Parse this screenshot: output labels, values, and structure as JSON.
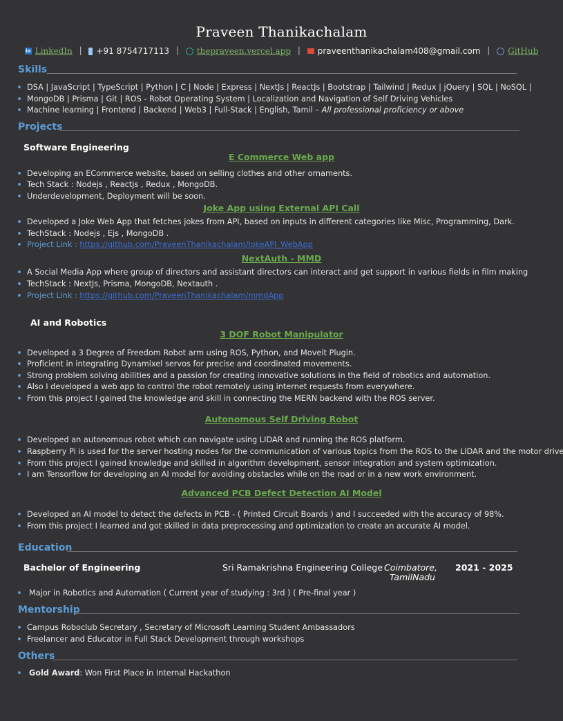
{
  "header": {
    "name": "Praveen Thanikachalam",
    "linkedin": "LinkedIn",
    "phone": "+91 8754717113",
    "website": "thepraveen.vercel.app",
    "email": "praveenthanikachalam408@gmail.com",
    "github": "GitHub",
    "separator": "|"
  },
  "skills": {
    "title": "Skills",
    "lines": [
      "DSA |  JavaScript | TypeScript | Python | C | Node | Express | NextJs | ReactJs | Bootstrap | Tailwind | Redux | jQuery | SQL | NoSQL |",
      "MongoDB | Prisma | Git | ROS - Robot Operating System | Localization and Navigation of Self Driving Vehicles",
      "Machine learning | Frontend | Backend | Web3 | Full-Stack | English, Tamil – "
    ],
    "proficiency": "All professional proficiency or above"
  },
  "projects": {
    "title": "Projects",
    "software": {
      "title": "Software Engineering",
      "items": [
        {
          "name": "E Commerce Web app",
          "bullets": [
            "Developing an ECommerce website, based on selling clothes and other ornaments.",
            "Tech Stack : Nodejs , Reactjs , Redux , MongoDB.",
            "Underdevelopment, Deployment will be soon."
          ]
        },
        {
          "name": "Joke App using External API Call",
          "bullets": [
            "Developed a Joke Web App that fetches jokes from API, based on inputs in different categories like Misc, Programming, Dark.",
            "TechStack : Nodejs , Ejs , MongoDB ."
          ],
          "link_label": "Project Link : ",
          "link": "https://github.com/PraveenThanikachalam/JokeAPI_WebApp"
        },
        {
          "name": "NextAuth - MMD",
          "bullets": [
            "A Social Media App  where group of directors and assistant directors can interact and get support in various fields in film making",
            "TechStack : NextJs, Prisma, MongoDB, Nextauth ."
          ],
          "link_label": "Project Link : ",
          "link": "https://github.com/PraveenThanikachalam/mmdApp"
        }
      ]
    },
    "ai": {
      "title": "AI and Robotics",
      "items": [
        {
          "name": "3 DOF Robot Manipulator",
          "bullets": [
            "Developed a 3 Degree of Freedom Robot arm using ROS, Python, and Moveit Plugin.",
            "Proficient in integrating Dynamixel servos for precise and coordinated movements.",
            "Strong problem solving abilities and a passion for creating innovative solutions in the field of robotics and automation.",
            "Also I developed a web app to control the robot remotely using internet requests from everywhere.",
            "From this project I gained the knowledge and skill in connecting the MERN backend with the ROS server."
          ]
        },
        {
          "name": "Autonomous Self Driving Robot",
          "bullets": [
            "Developed an autonomous robot which can navigate using LIDAR and running the ROS platform.",
            "Raspberry Pi is used for the server hosting nodes for the communication of various topics from the ROS to the LIDAR and the motor driver.",
            "From this project I gained knowledge and skilled in algorithm development, sensor integration and system optimization.",
            "I am Tensorflow for developing an AI model for avoiding obstacles while on the road or in a new work environment."
          ]
        },
        {
          "name": "Advanced PCB Defect Detection AI Model",
          "bullets": [
            "Developed an AI model to detect the defects in PCB - ( Printed Circuit Boards ) and I succeeded with the accuracy of 98%.",
            "From this project I learned and got skilled in data preprocessing and optimization to create an accurate AI model."
          ]
        }
      ]
    }
  },
  "education": {
    "title": "Education",
    "degree": "Bachelor of Engineering",
    "college": "Sri Ramakrishna Engineering College",
    "city": "Coimbatore,",
    "state": "TamilNadu",
    "years": "2021 - 2025",
    "bullet": "Major in Robotics and Automation ( Current year of studying : 3rd ) ( Pre-final year )"
  },
  "mentorship": {
    "title": "Mentorship",
    "bullets": [
      "Campus Roboclub Secretary , Secretary of Microsoft Learning Student Ambassadors",
      "Freelancer and Educator in Full Stack Development through workshops"
    ]
  },
  "others": {
    "title": "Others",
    "award_label": "Gold Award",
    "award_text": ": Won First Place in Internal Hackathon"
  }
}
